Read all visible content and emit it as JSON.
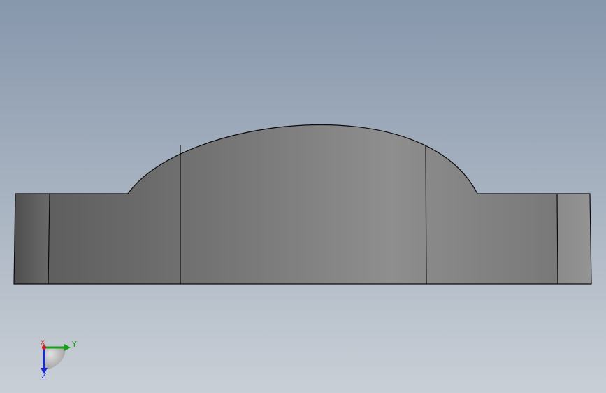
{
  "viewport": {
    "background_top": "#8797ac",
    "background_bottom": "#c9cfd6"
  },
  "model": {
    "edge_color": "#0c0c0c",
    "shade_dark": "#5a5a5a",
    "shade_mid": "#747474",
    "shade_light": "#8e8e8e"
  },
  "triad": {
    "x_label": "X",
    "y_label": "Y",
    "z_label": "Z",
    "x_color": "#d41a1a",
    "y_color": "#13a313",
    "z_color": "#1a2bc9"
  }
}
